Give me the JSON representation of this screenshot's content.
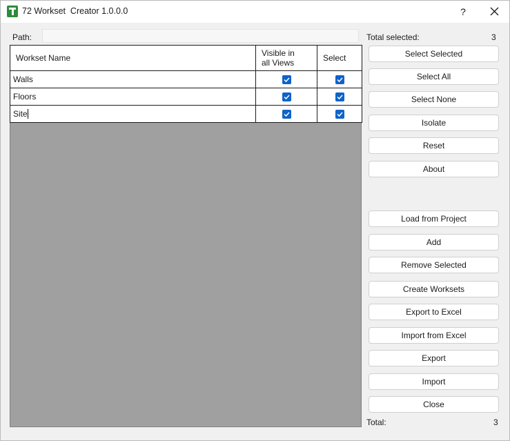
{
  "window": {
    "title": "72 Workset  Creator 1.0.0.0",
    "help": "?"
  },
  "path": {
    "label": "Path:",
    "value": ""
  },
  "summary": {
    "total_selected_label": "Total selected:",
    "total_selected_count": "3",
    "total_label": "Total:",
    "total_count": "3"
  },
  "grid": {
    "headers": {
      "name": "Workset Name",
      "visible_line1": "Visible in",
      "visible_line2": "all Views",
      "select": "Select"
    },
    "rows": [
      {
        "name": "Walls",
        "visible": true,
        "select": true
      },
      {
        "name": "Floors",
        "visible": true,
        "select": true
      },
      {
        "name": "Site",
        "visible": true,
        "select": true
      }
    ]
  },
  "buttons": {
    "select_selected": "Select Selected",
    "select_all": "Select All",
    "select_none": "Select None",
    "isolate": "Isolate",
    "reset": "Reset",
    "about": "About",
    "load_from_project": "Load from Project",
    "add": "Add",
    "remove_selected": "Remove Selected",
    "create_worksets": "Create Worksets",
    "export_to_excel": "Export to Excel",
    "import_from_excel": "Import from Excel",
    "export": "Export",
    "import": "Import",
    "close": "Close"
  },
  "colors": {
    "accent": "#0f63c9",
    "grid_bg": "#a0a0a0",
    "window_bg": "#f0f0f0",
    "brand_icon": "#2e8b3a"
  }
}
